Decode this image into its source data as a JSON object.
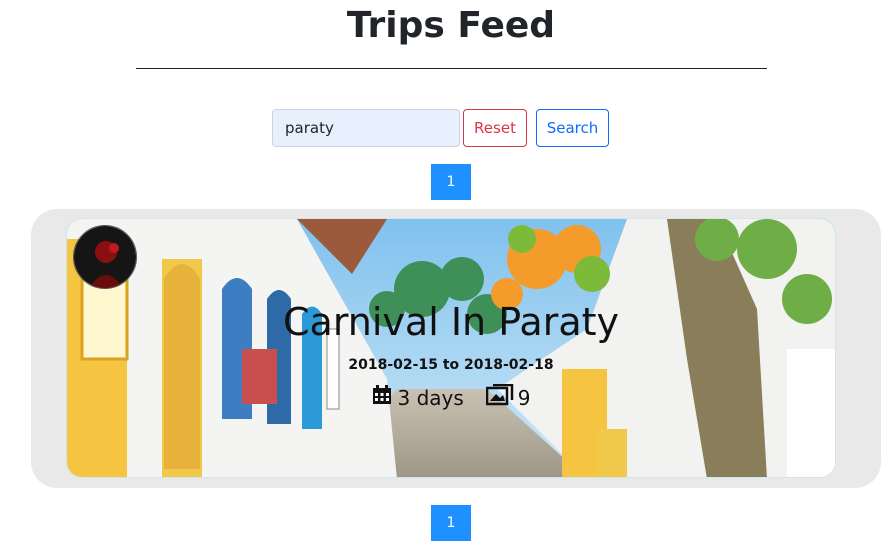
{
  "header": {
    "title": "Trips Feed"
  },
  "search": {
    "value": "paraty",
    "reset_label": "Reset",
    "search_label": "Search"
  },
  "pagination": {
    "current_page": "1"
  },
  "trip": {
    "title": "Carnival In Paraty",
    "dates": "2018-02-15 to 2018-02-18",
    "duration": "3 days",
    "photo_count": "9",
    "duration_icon": "calendar-icon",
    "photos_icon": "photos-icon"
  },
  "colors": {
    "reset": "#dc3545",
    "search": "#0d6efd",
    "page_button": "#1e90ff"
  }
}
